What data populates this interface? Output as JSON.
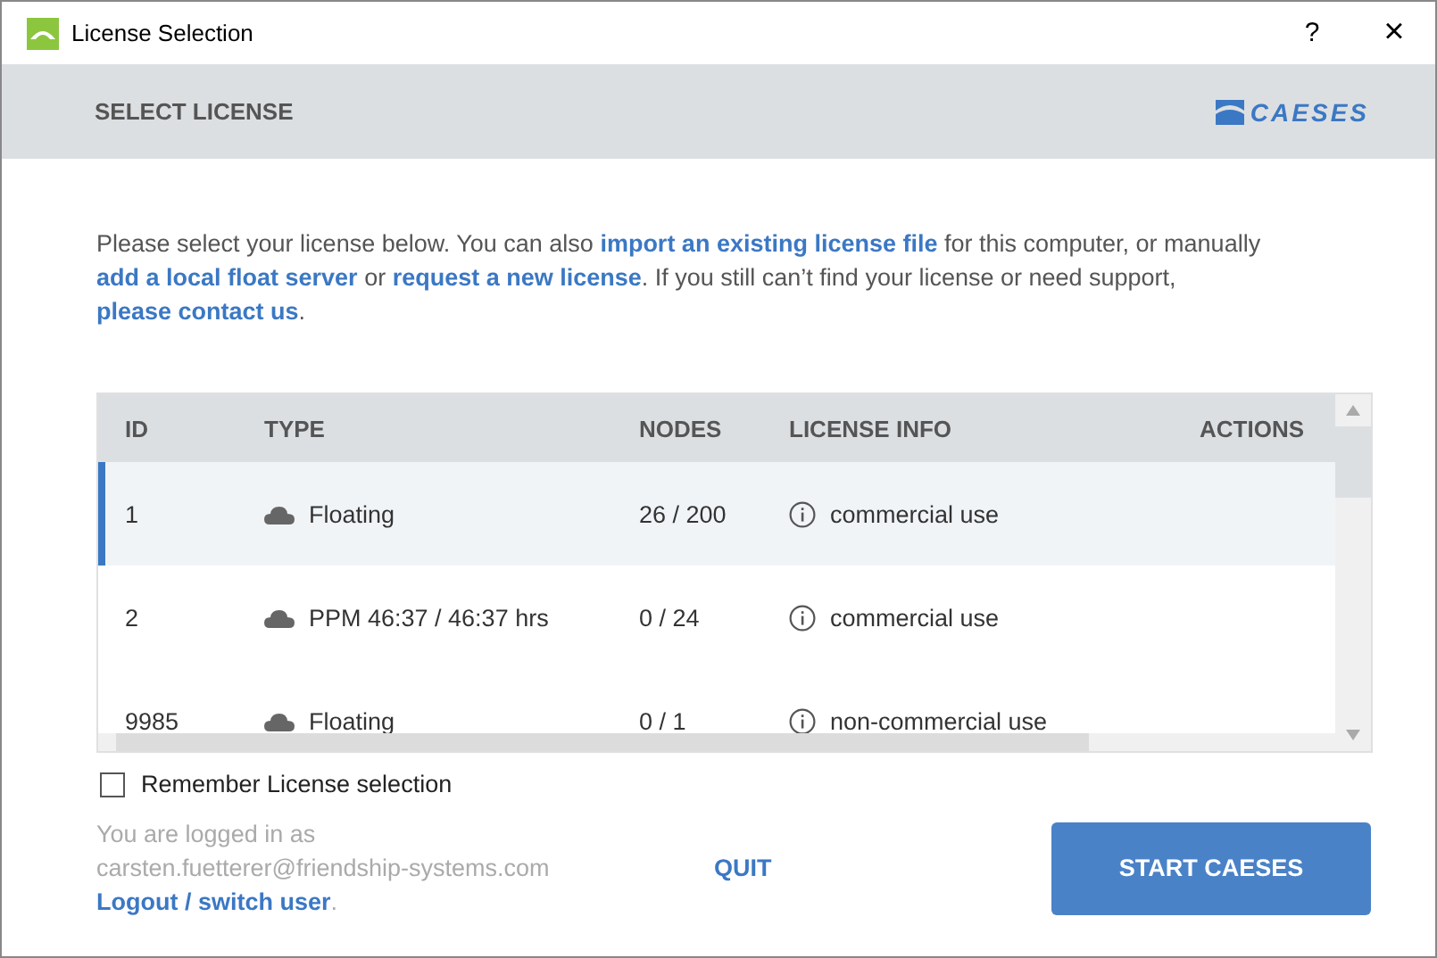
{
  "window": {
    "title": "License Selection",
    "help": "?",
    "close": "×"
  },
  "header": {
    "title": "SELECT LICENSE",
    "logo_text": "CAESES"
  },
  "intro": [
    {
      "kind": "text",
      "text": "Please select your license below. You can also "
    },
    {
      "kind": "link",
      "text": "import an existing license file"
    },
    {
      "kind": "text",
      "text": " for this computer, or manually "
    },
    {
      "kind": "link",
      "text": "add a local float server"
    },
    {
      "kind": "text",
      "text": " or "
    },
    {
      "kind": "link",
      "text": "request a new license"
    },
    {
      "kind": "text",
      "text": ". If you still can’t find your license or need support, "
    },
    {
      "kind": "link",
      "text": "please contact us"
    },
    {
      "kind": "text",
      "text": "."
    }
  ],
  "table": {
    "columns": [
      "ID",
      "TYPE",
      "NODES",
      "LICENSE INFO",
      "ACTIONS"
    ],
    "rows": [
      {
        "id": "1",
        "type": "Floating",
        "nodes": "26 / 200",
        "info": "commercial use",
        "selected": true
      },
      {
        "id": "2",
        "type": "PPM 46:37 / 46:37 hrs",
        "nodes": "0 / 24",
        "info": "commercial use",
        "selected": false
      },
      {
        "id": "9985",
        "type": "Floating",
        "nodes": "0 / 1",
        "info": "non-commercial use",
        "selected": false
      }
    ]
  },
  "remember": {
    "label": "Remember License selection",
    "checked": false
  },
  "footer": {
    "logged_in_text": "You are logged in as",
    "email": "carsten.fuetterer@friendship-systems.com",
    "logout_link": "Logout / switch user",
    "logout_suffix": ".",
    "quit": "QUIT",
    "start": "START CAESES"
  }
}
